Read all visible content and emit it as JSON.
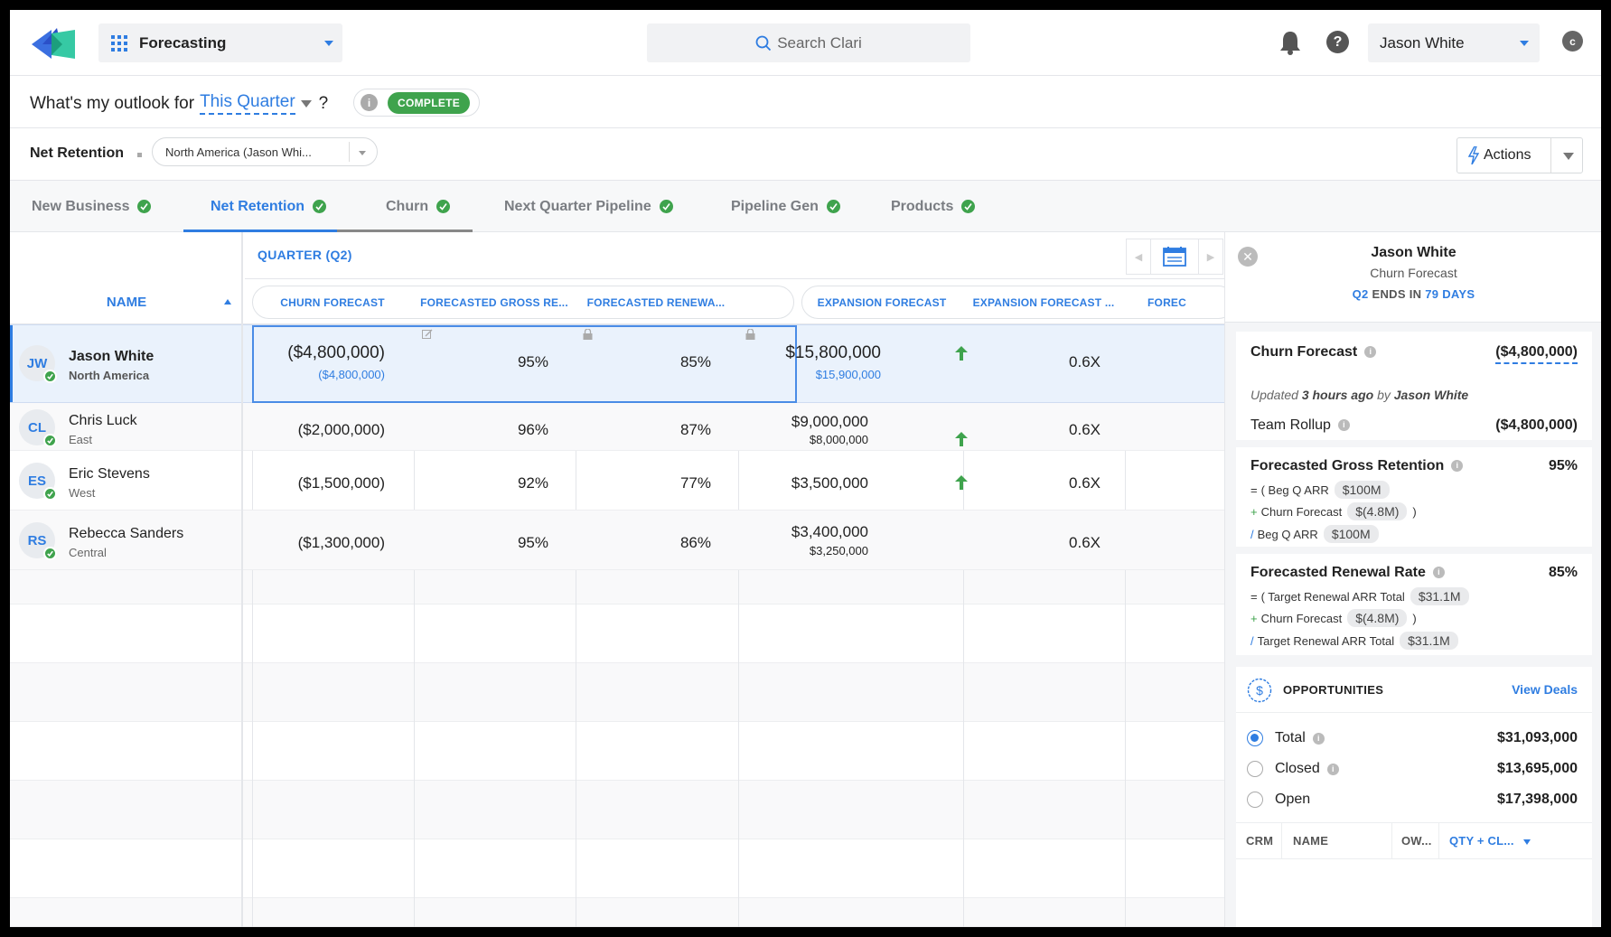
{
  "topbar": {
    "app_name": "Forecasting",
    "search_placeholder": "Search Clari",
    "user_name": "Jason White"
  },
  "outlook": {
    "question_prefix": "What's my outlook for",
    "period": "This Quarter",
    "question_suffix": "?",
    "status": "COMPLETE"
  },
  "filters": {
    "label": "Net Retention",
    "scope": "North America (Jason Whi...",
    "actions_label": "Actions"
  },
  "tabs": [
    {
      "label": "New Business"
    },
    {
      "label": "Net Retention"
    },
    {
      "label": "Churn"
    },
    {
      "label": "Next Quarter Pipeline"
    },
    {
      "label": "Pipeline Gen"
    },
    {
      "label": "Products"
    }
  ],
  "table": {
    "period_label": "QUARTER (Q2)",
    "name_header": "NAME",
    "columns": [
      "CHURN FORECAST",
      "FORECASTED GROSS RE...",
      "FORECASTED RENEWA...",
      "EXPANSION FORECAST",
      "EXPANSION FORECAST ...",
      "FOREC"
    ],
    "rows": [
      {
        "initials": "JW",
        "name": "Jason White",
        "region": "North America",
        "churn": "($4,800,000)",
        "churn_sub": "($4,800,000)",
        "gross": "95%",
        "renewal": "85%",
        "expansion": "$15,800,000",
        "expansion_sub": "$15,900,000",
        "exp_mult": "0.6X"
      },
      {
        "initials": "CL",
        "name": "Chris Luck",
        "region": "East",
        "churn": "($2,000,000)",
        "gross": "96%",
        "renewal": "87%",
        "expansion": "$9,000,000",
        "expansion_sub": "$8,000,000",
        "exp_mult": "0.6X"
      },
      {
        "initials": "ES",
        "name": "Eric Stevens",
        "region": "West",
        "churn": "($1,500,000)",
        "gross": "92%",
        "renewal": "77%",
        "expansion": "$3,500,000",
        "exp_mult": "0.6X"
      },
      {
        "initials": "RS",
        "name": "Rebecca Sanders",
        "region": "Central",
        "churn": "($1,300,000)",
        "gross": "95%",
        "renewal": "86%",
        "expansion": "$3,400,000",
        "expansion_sub": "$3,250,000",
        "exp_mult": "0.6X"
      }
    ]
  },
  "panel": {
    "name": "Jason White",
    "subtitle": "Churn Forecast",
    "ends_q": "Q2",
    "ends_text": "ENDS IN",
    "ends_days": "79 DAYS",
    "churn_title": "Churn Forecast",
    "churn_value": "($4,800,000)",
    "updated_prefix": "Updated",
    "updated_when": "3 hours ago",
    "updated_by_word": "by",
    "updated_by": "Jason White",
    "team_rollup_label": "Team Rollup",
    "team_rollup_value": "($4,800,000)",
    "gross": {
      "title": "Forecasted Gross Retention",
      "value": "95%",
      "l1_op": "=",
      "l1_text": "( Beg Q ARR",
      "l1_chip": "$100M",
      "l2_op": "+",
      "l2_text": "Churn Forecast",
      "l2_chip": "$(4.8M)",
      "l2_close": ")",
      "l3_op": "/",
      "l3_text": "Beg Q ARR",
      "l3_chip": "$100M"
    },
    "renewal": {
      "title": "Forecasted Renewal Rate",
      "value": "85%",
      "l1_op": "=",
      "l1_text": "( Target Renewal ARR Total",
      "l1_chip": "$31.1M",
      "l2_op": "+",
      "l2_text": "Churn Forecast",
      "l2_chip": "$(4.8M)",
      "l2_close": ")",
      "l3_op": "/",
      "l3_text": "Target Renewal ARR Total",
      "l3_chip": "$31.1M"
    },
    "opps": {
      "title": "OPPORTUNITIES",
      "link": "View Deals",
      "total_label": "Total",
      "total_value": "$31,093,000",
      "closed_label": "Closed",
      "closed_value": "$13,695,000",
      "open_label": "Open",
      "open_value": "$17,398,000",
      "cols": [
        "CRM",
        "NAME",
        "OW...",
        "QTY + CL..."
      ]
    }
  }
}
